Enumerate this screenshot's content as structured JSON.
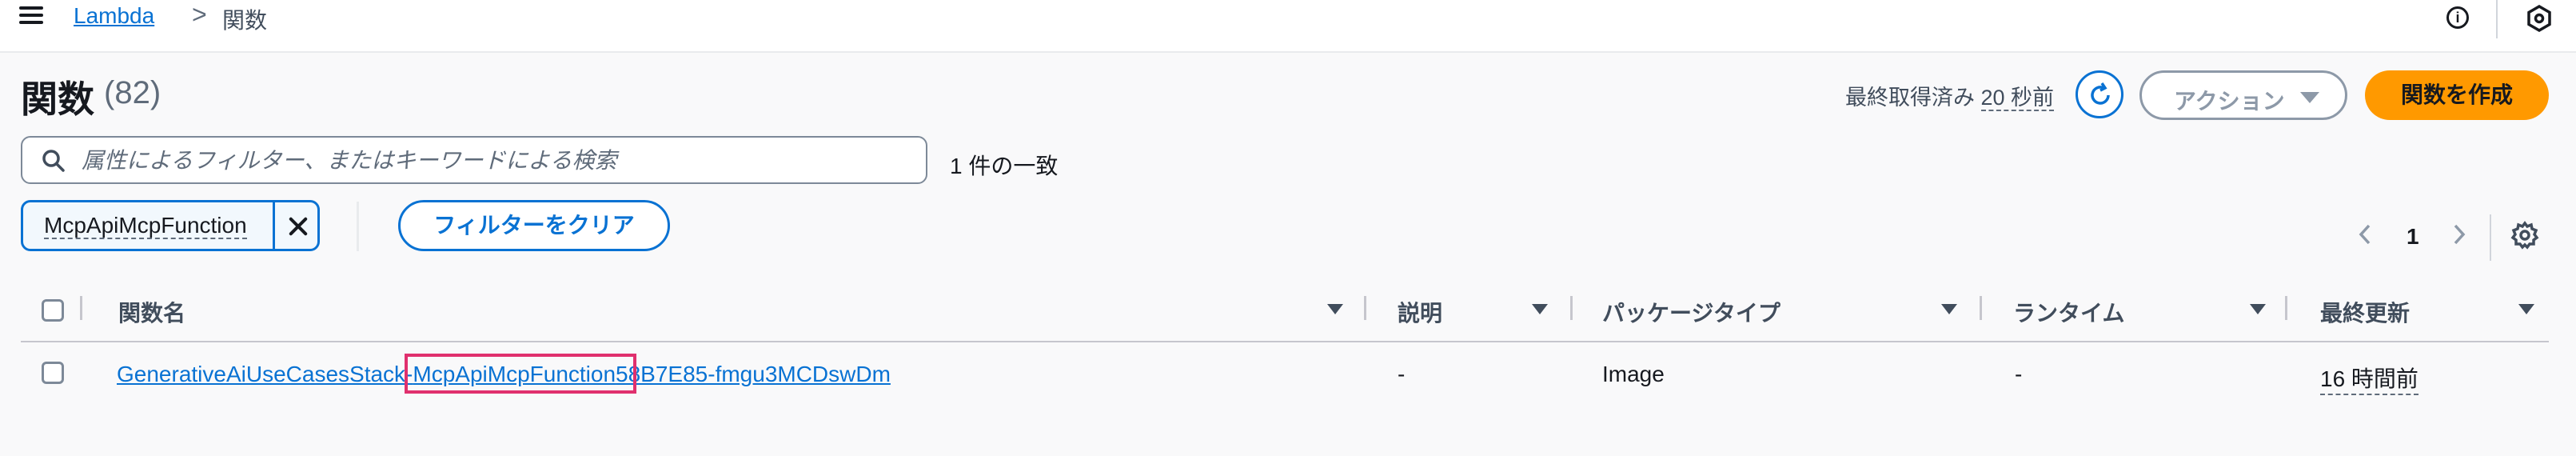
{
  "topbar": {
    "breadcrumb_link": "Lambda",
    "breadcrumb_separator": ">",
    "breadcrumb_current": "関数",
    "info_icon": "info-icon",
    "info_glyph": "i",
    "hex_icon": "settings-hex-icon"
  },
  "header": {
    "title": "関数",
    "count": "(82)",
    "last_fetched_label": "最終取得済み",
    "last_fetched_value": "20 秒前",
    "actions_label": "アクション",
    "create_label": "関数を作成",
    "accent_color": "#0972d3",
    "primary_color": "#ff9900"
  },
  "filter": {
    "search_placeholder": "属性によるフィルター、またはキーワードによる検索",
    "match_text": "1 件の一致",
    "token_label": "McpApiMcpFunction",
    "clear_label": "フィルターをクリア"
  },
  "pagination": {
    "page": "1"
  },
  "table": {
    "columns": [
      "関数名",
      "説明",
      "パッケージタイプ",
      "ランタイム",
      "最終更新"
    ],
    "rows": [
      {
        "name": "GenerativeAiUseCasesStack-McpApiMcpFunction58B7E85-fmgu3MCDswDm",
        "name_prefix": "GenerativeAiUseCasesStack-",
        "name_highlight": "McpApiMcpFunction",
        "name_suffix": "58B7E85-fmgu3MCDswDm",
        "description": "-",
        "package_type": "Image",
        "runtime": "-",
        "last_modified": "16 時間前"
      }
    ],
    "highlight_color": "#e0306e"
  }
}
